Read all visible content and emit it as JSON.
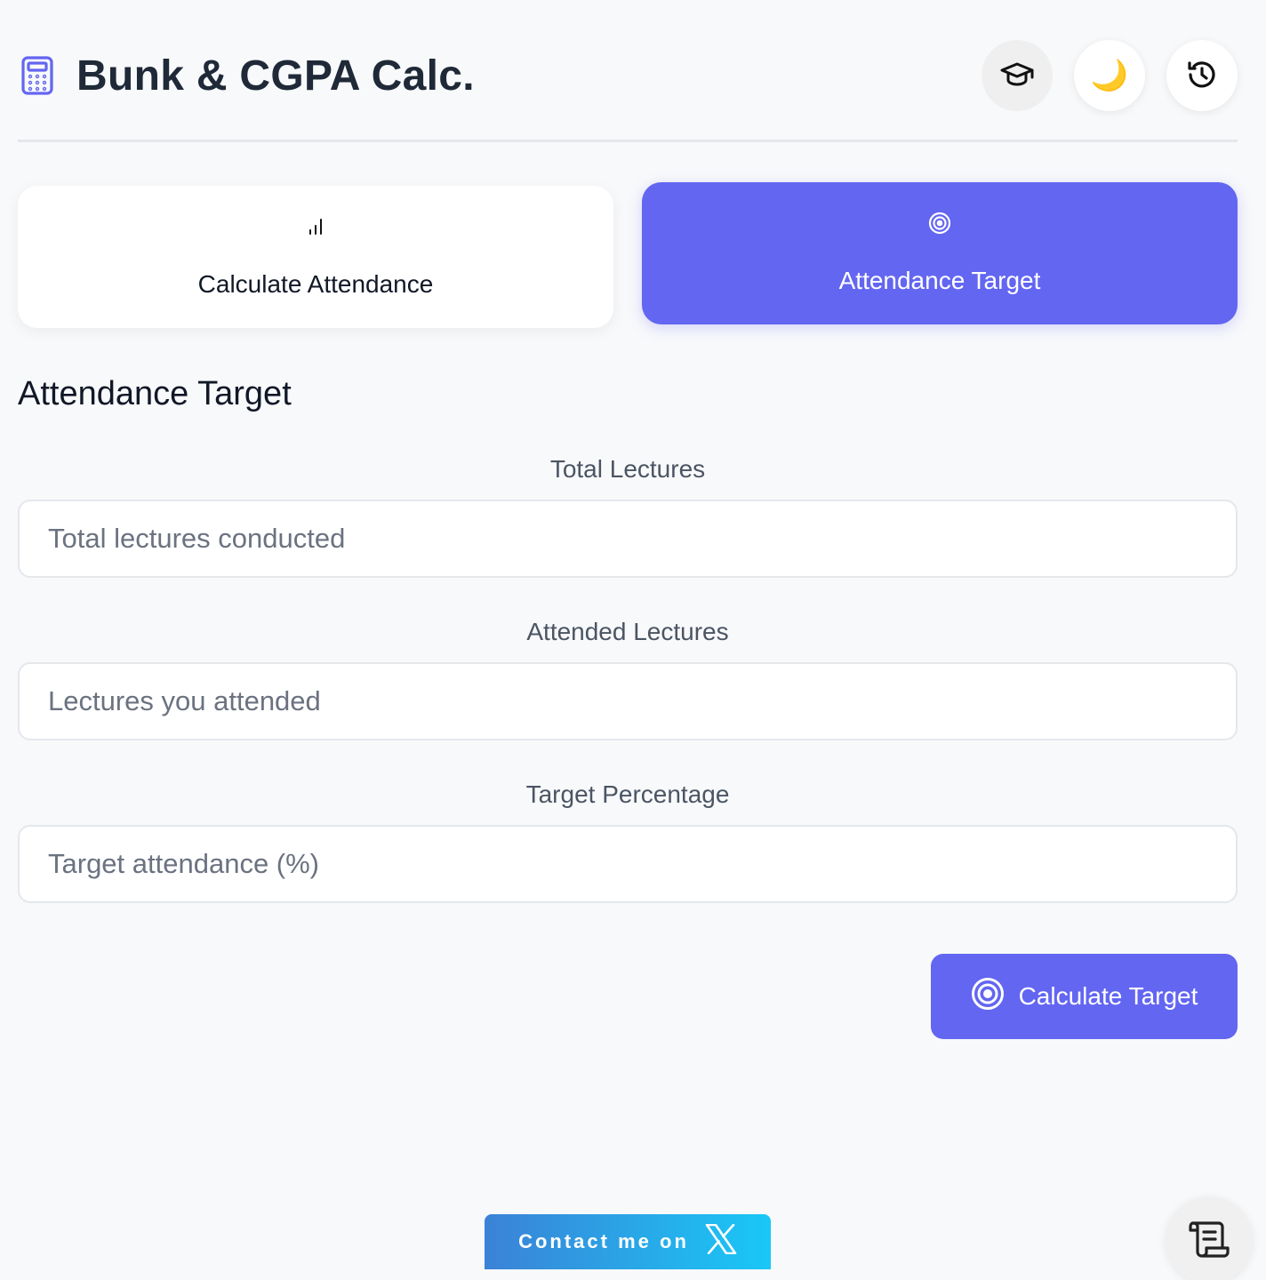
{
  "app": {
    "title": "Bunk & CGPA Calc.",
    "accent_color": "#6366f1"
  },
  "header": {
    "buttons": [
      {
        "name": "graduation-cap",
        "icon": "graduation-cap-icon"
      },
      {
        "name": "theme-toggle",
        "icon": "moon-icon",
        "glyph": "🌙"
      },
      {
        "name": "history",
        "icon": "history-icon"
      }
    ]
  },
  "modes": {
    "calculate": {
      "label": "Calculate Attendance",
      "icon": "bar-chart-icon"
    },
    "target": {
      "label": "Attendance Target",
      "icon": "target-icon",
      "active": true
    }
  },
  "form": {
    "title": "Attendance Target",
    "fields": [
      {
        "label": "Total Lectures",
        "placeholder": "Total lectures conducted",
        "value": ""
      },
      {
        "label": "Attended Lectures",
        "placeholder": "Lectures you attended",
        "value": ""
      },
      {
        "label": "Target Percentage",
        "placeholder": "Target attendance (%)",
        "value": ""
      }
    ],
    "submit_label": "Calculate Target"
  },
  "footer": {
    "contact_label": "Contact me on",
    "contact_icon": "x-logo-icon",
    "scroll_icon": "scroll-icon"
  }
}
